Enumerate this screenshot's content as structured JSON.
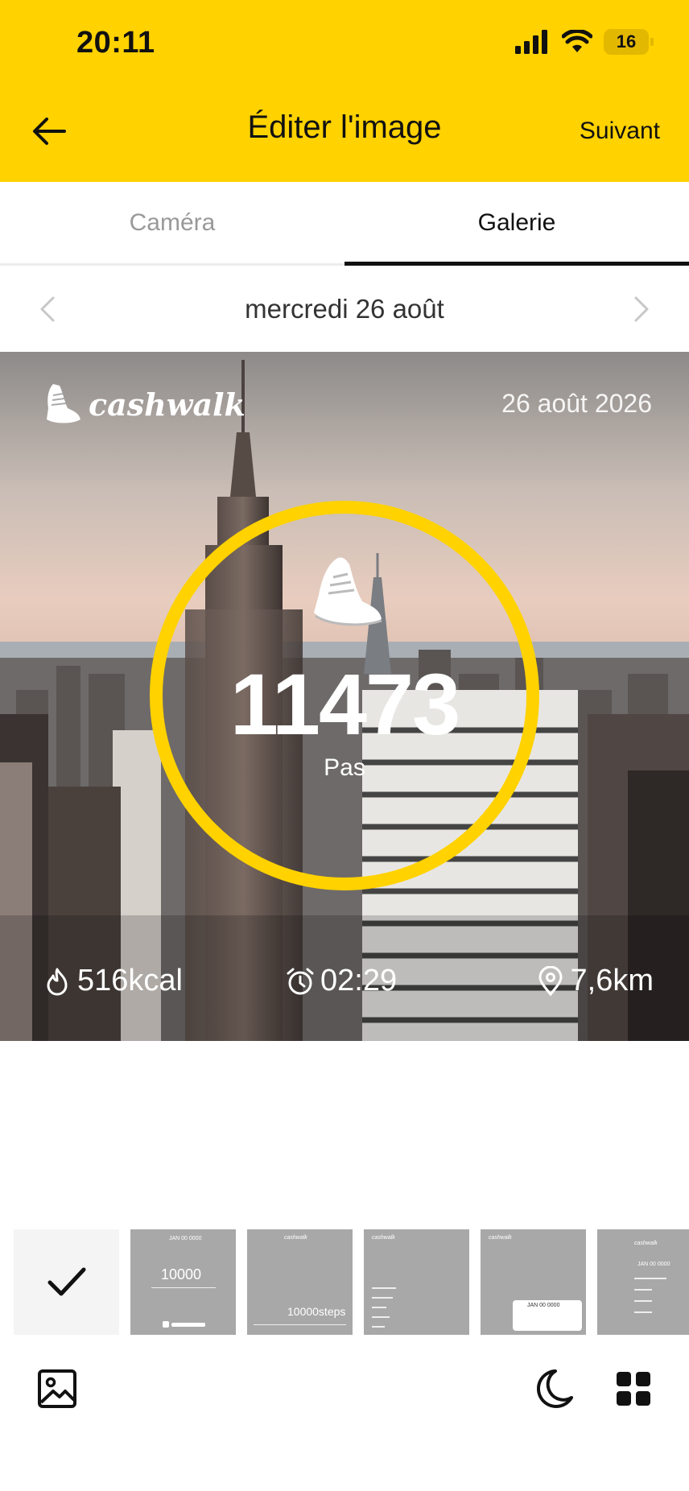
{
  "status": {
    "time": "20:11",
    "battery": "16"
  },
  "header": {
    "title": "Éditer l'image",
    "next_label": "Suivant"
  },
  "tabs": [
    {
      "label": "Caméra",
      "active": false
    },
    {
      "label": "Galerie",
      "active": true
    }
  ],
  "date_nav": {
    "label": "mercredi 26 août"
  },
  "card": {
    "brand": "cashwalk",
    "date": "26 août 2026",
    "steps": "11473",
    "steps_label": "Pas",
    "calories": "516kcal",
    "duration": "02:29",
    "distance": "7,6km",
    "accent_color": "#FFD200"
  },
  "thumbnails": {
    "t2": {
      "date": "JAN 00 0000",
      "steps": "10000"
    },
    "t3": {
      "brand": "cashwalk",
      "steps": "10000steps"
    },
    "t4": {
      "brand": "cashwalk"
    },
    "t5": {
      "brand": "cashwalk",
      "date": "JAN 00 0000"
    },
    "t6": {
      "brand": "cashwalk",
      "date": "JAN 00 0000"
    }
  },
  "icons": {
    "back": "arrow-left-icon",
    "gallery": "image-icon",
    "night": "moon-icon",
    "layout": "grid-icon"
  }
}
